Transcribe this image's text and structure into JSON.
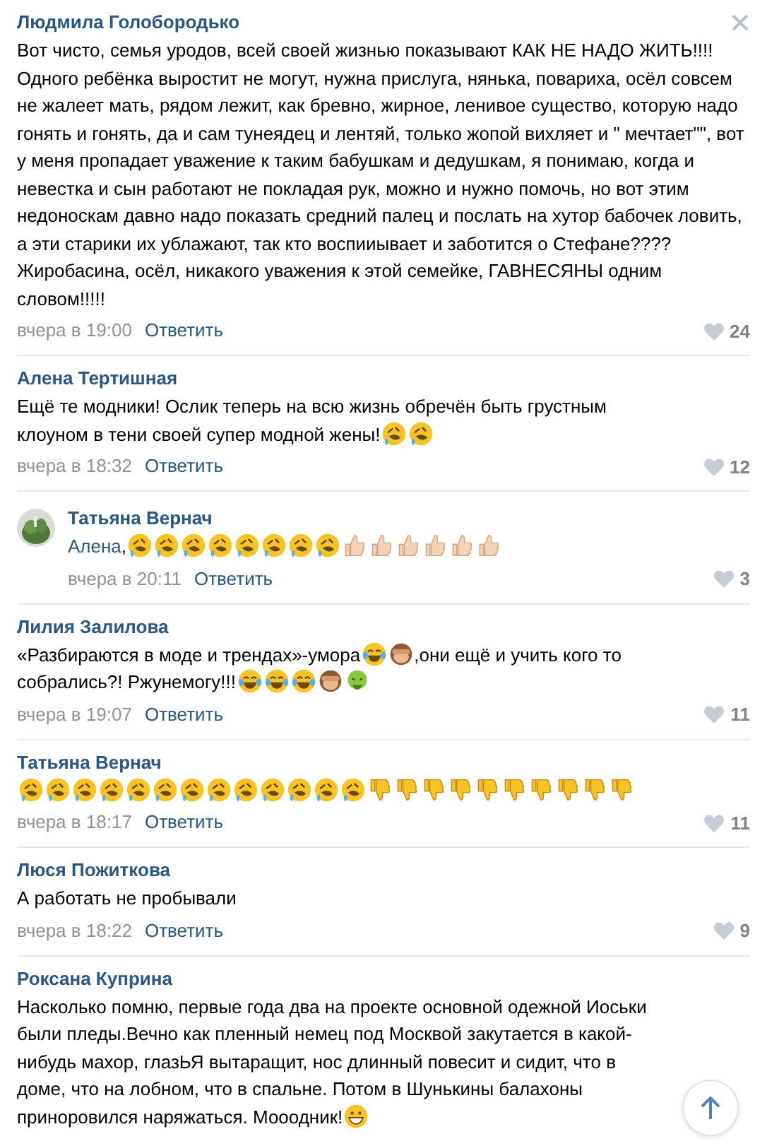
{
  "comments": [
    {
      "author": "Людмила Голобородько",
      "parts": [
        {
          "kind": "text",
          "text": "Вот чисто, семья уродов, всей своей жизнью показывают КАК НЕ НАДО ЖИТЬ!!!! Одного ребёнка выростит не могут, нужна прислуга, нянька, повариха, осёл совсем не жалеет мать, рядом лежит, как бревно, жирное, ленивое существо, которую надо гонять и гонять, да и сам тунеядец и лентяй, только жопой вихляет и \" мечтает\"\", вот у меня пропадает уважение к таким бабушкам и дедушкам, я понимаю, когда и невестка и сын работают не покладая рук, можно и нужно помочь, но вот этим недоноскам давно надо показать средний палец и послать на хутор бабочек ловить, а эти старики их ублажают, так кто воспииывает и заботится о Стефане???? Жиробасина, осёл, никакого уважения к этой семейке, ГАВНЕСЯНЫ одним словом!!!!!"
        }
      ],
      "time": "вчера в 19:00",
      "reply": "Ответить",
      "likes": "24",
      "closable": true
    },
    {
      "author": "Алена Тертишная",
      "parts": [
        {
          "kind": "text",
          "text": "Ещё те модники! Ослик теперь на всю жизнь обречён быть грустным"
        },
        {
          "kind": "text",
          "text": "клоуном в тени своей супер модной жены!"
        },
        {
          "kind": "rofl"
        },
        {
          "kind": "rofl"
        }
      ],
      "time": "вчера в 18:32",
      "reply": "Ответить",
      "likes": "12",
      "closable": false,
      "children": [
        {
          "author": "Татьяна Вернач",
          "parts": [
            {
              "kind": "mention",
              "text": "Алена"
            },
            {
              "kind": "text",
              "text": ","
            },
            {
              "kind": "rofl"
            },
            {
              "kind": "rofl"
            },
            {
              "kind": "rofl"
            },
            {
              "kind": "rofl"
            },
            {
              "kind": "rofl"
            },
            {
              "kind": "rofl"
            },
            {
              "kind": "rofl"
            },
            {
              "kind": "rofl"
            },
            {
              "kind": "thumbs-up"
            },
            {
              "kind": "thumbs-up"
            },
            {
              "kind": "thumbs-up"
            },
            {
              "kind": "thumbs-up"
            },
            {
              "kind": "thumbs-up"
            },
            {
              "kind": "thumbs-up"
            }
          ],
          "time": "вчера в 20:11",
          "reply": "Ответить",
          "likes": "3",
          "closable": false
        }
      ]
    },
    {
      "author": "Лилия Залилова",
      "parts": [
        {
          "kind": "text",
          "text": "«Разбираются в моде и трендах»-умора"
        },
        {
          "kind": "joy"
        },
        {
          "kind": "monkey"
        },
        {
          "kind": "text",
          "text": ",они ещё и учить кого то"
        },
        {
          "kind": "text",
          "text": "собрались?! Ржунемогу!!!"
        },
        {
          "kind": "joy"
        },
        {
          "kind": "joy"
        },
        {
          "kind": "joy"
        },
        {
          "kind": "monkey"
        },
        {
          "kind": "sick"
        }
      ],
      "time": "вчера в 19:07",
      "reply": "Ответить",
      "likes": "11",
      "closable": false
    },
    {
      "author": "Татьяна Вернач",
      "parts": [
        {
          "kind": "rofl"
        },
        {
          "kind": "rofl"
        },
        {
          "kind": "rofl"
        },
        {
          "kind": "rofl"
        },
        {
          "kind": "rofl"
        },
        {
          "kind": "rofl"
        },
        {
          "kind": "rofl"
        },
        {
          "kind": "rofl"
        },
        {
          "kind": "rofl"
        },
        {
          "kind": "rofl"
        },
        {
          "kind": "rofl"
        },
        {
          "kind": "rofl"
        },
        {
          "kind": "rofl"
        },
        {
          "kind": "thumbs-down"
        },
        {
          "kind": "thumbs-down"
        },
        {
          "kind": "thumbs-down"
        },
        {
          "kind": "thumbs-down"
        },
        {
          "kind": "thumbs-down"
        },
        {
          "kind": "thumbs-down"
        },
        {
          "kind": "thumbs-down"
        },
        {
          "kind": "thumbs-down"
        },
        {
          "kind": "thumbs-down"
        },
        {
          "kind": "thumbs-down"
        }
      ],
      "time": "вчера в 18:17",
      "reply": "Ответить",
      "likes": "11",
      "closable": false
    },
    {
      "author": "Люся Пожиткова",
      "parts": [
        {
          "kind": "text",
          "text": "А работать не пробывали"
        }
      ],
      "time": "вчера в 18:22",
      "reply": "Ответить",
      "likes": "9",
      "closable": false
    },
    {
      "author": "Роксана Куприна",
      "parts": [
        {
          "kind": "text",
          "text": "Насколько помню, первые года два на проекте основной одежной Иоськи"
        },
        {
          "kind": "text",
          "text": "были пледы.Вечно как пленный немец под Москвой закутается в какой-"
        },
        {
          "kind": "text",
          "text": "нибудь махор, глазЬЯ вытаращит, нос длинный повесит и сидит, что в"
        },
        {
          "kind": "text",
          "text": "доме, что на лобном, что в спальне. Потом в Шунькины балахоны"
        },
        {
          "kind": "text",
          "text": "приноровился наряжаться. Мооодник!"
        },
        {
          "kind": "grin"
        }
      ],
      "closable": false
    }
  ]
}
